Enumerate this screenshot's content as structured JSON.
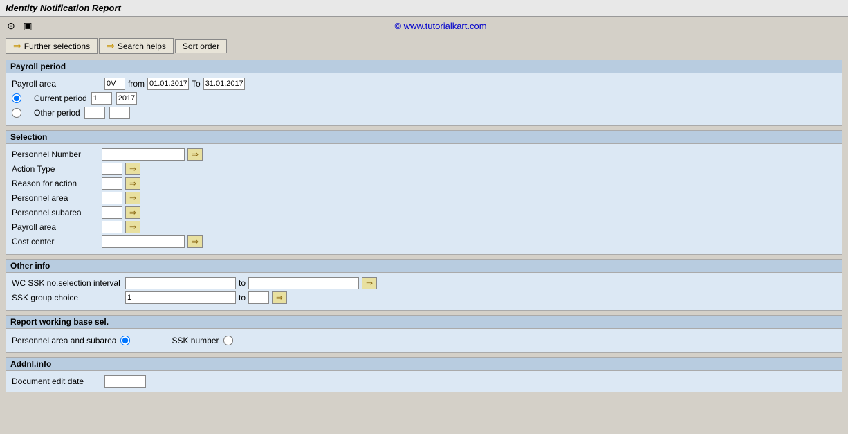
{
  "title": "Identity Notification Report",
  "watermark": "© www.tutorialkart.com",
  "toolbar": {
    "icons": [
      "clock",
      "page"
    ]
  },
  "tabs": [
    {
      "label": "Further selections",
      "arrow": true
    },
    {
      "label": "Search helps",
      "arrow": true
    },
    {
      "label": "Sort order",
      "arrow": false
    }
  ],
  "payroll_period": {
    "section_title": "Payroll period",
    "payroll_area_label": "Payroll area",
    "payroll_area_value": "0V",
    "from_label": "from",
    "from_value": "01.01.2017",
    "to_label": "To",
    "to_value": "31.01.2017",
    "current_period_label": "Current period",
    "current_period_num": "1",
    "current_period_year": "2017",
    "other_period_label": "Other period"
  },
  "selection": {
    "section_title": "Selection",
    "fields": [
      {
        "label": "Personnel Number",
        "size": "lg"
      },
      {
        "label": "Action Type",
        "size": "sm"
      },
      {
        "label": "Reason for action",
        "size": "sm"
      },
      {
        "label": "Personnel area",
        "size": "sm"
      },
      {
        "label": "Personnel subarea",
        "size": "sm"
      },
      {
        "label": "Payroll area",
        "size": "sm"
      },
      {
        "label": "Cost center",
        "size": "lg"
      }
    ]
  },
  "other_info": {
    "section_title": "Other info",
    "fields": [
      {
        "label": "WC SSK no.selection interval",
        "input1_size": "xl",
        "to_label": "to",
        "input2_size": "xl"
      },
      {
        "label": "SSK group choice",
        "value": "1",
        "to_label": "to",
        "input2_size": "sm"
      }
    ]
  },
  "report_working_base": {
    "section_title": "Report working base sel.",
    "items": [
      {
        "label": "Personnel area and subarea",
        "checked": true
      },
      {
        "label": "SSK number",
        "checked": false
      }
    ]
  },
  "addnl_info": {
    "section_title": "Addnl.info",
    "fields": [
      {
        "label": "Document edit date",
        "size": "md"
      }
    ]
  }
}
